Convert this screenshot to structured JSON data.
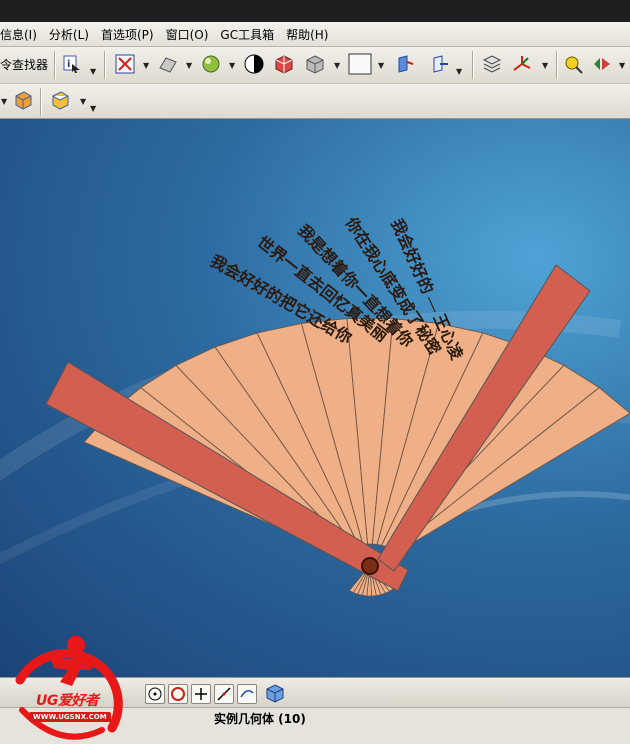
{
  "menu": [
    "信息(I)",
    "分析(L)",
    "首选项(P)",
    "窗口(O)",
    "GC工具箱",
    "帮助(H)"
  ],
  "toolbar": {
    "command_finder": "令查找器"
  },
  "fan": {
    "lines": [
      "我会好好的 — 王心凌",
      "你在我心底变成了秘密",
      "我是想着你一直想着你",
      "世界一直去回忆真美丽",
      "我会好好的把它还给你"
    ],
    "colors": {
      "blade": "#f0b087",
      "guard": "#d35f50",
      "pivot": "#7a2e14"
    }
  },
  "status": {
    "text": "实例几何体 (10)"
  },
  "logo": {
    "brand": "UG爱好者",
    "url": "WWW.UGSNX.COM"
  }
}
